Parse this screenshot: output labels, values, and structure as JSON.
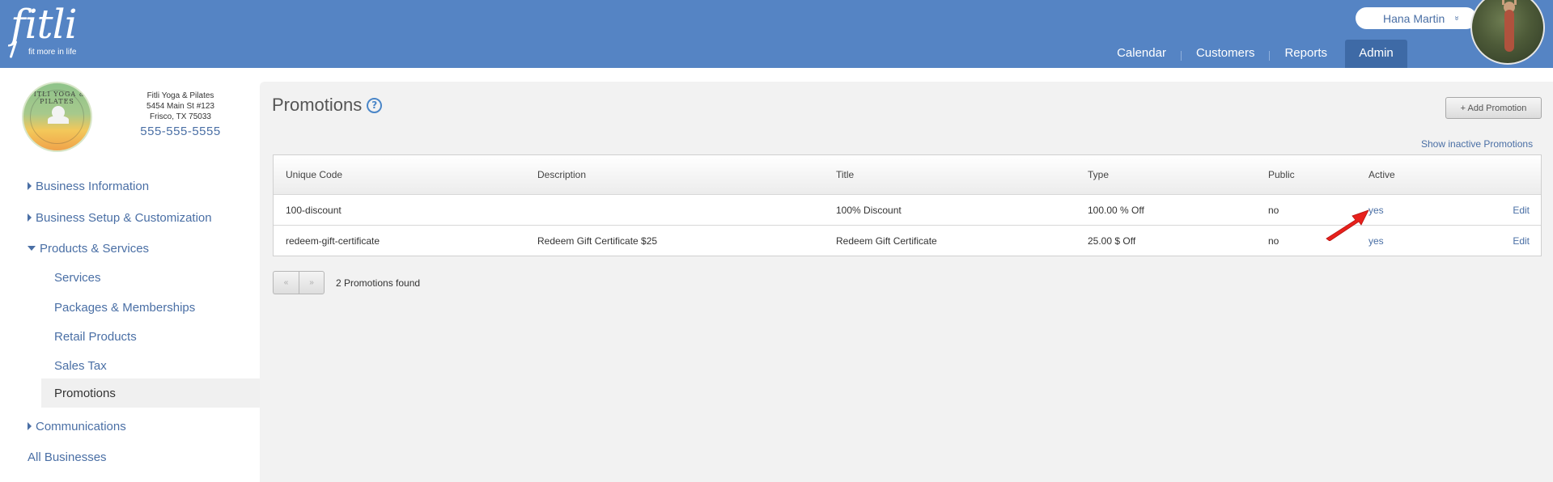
{
  "header": {
    "logo_word": "fitli",
    "logo_tagline": "fit more in life",
    "user_name": "Hana Martin",
    "user_chevron": "»",
    "nav": [
      "Calendar",
      "Customers",
      "Reports",
      "Admin"
    ],
    "active_nav": "Admin",
    "brand_color": "#5584c4"
  },
  "business": {
    "logo_text": "FITLI YOGA & PILATES",
    "name": "Fitli Yoga & Pilates",
    "address1": "5454 Main St #123",
    "address2": "Frisco, TX 75033",
    "phone": "555-555-5555"
  },
  "sidebar": {
    "items": [
      {
        "label": "Business Information",
        "caret": "right"
      },
      {
        "label": "Business Setup & Customization",
        "caret": "right"
      },
      {
        "label": "Products & Services",
        "caret": "down"
      },
      {
        "label": "Services"
      },
      {
        "label": "Packages & Memberships"
      },
      {
        "label": "Retail Products"
      },
      {
        "label": "Sales Tax"
      },
      {
        "label": "Promotions",
        "selected": true
      },
      {
        "label": "Communications",
        "caret": "right"
      },
      {
        "label": "All Businesses"
      }
    ]
  },
  "main": {
    "title": "Promotions",
    "help_icon": "?",
    "add_button": "+ Add Promotion",
    "show_inactive": "Show inactive Promotions",
    "columns": [
      "Unique Code",
      "Description",
      "Title",
      "Type",
      "Public",
      "Active",
      ""
    ],
    "rows": [
      {
        "code": "100-discount",
        "description": "",
        "title": "100% Discount",
        "type": "100.00 % Off",
        "public": "no",
        "active": "yes",
        "action": "Edit"
      },
      {
        "code": "redeem-gift-certificate",
        "description": "Redeem Gift Certificate $25",
        "title": "Redeem Gift Certificate",
        "type": "25.00 $ Off",
        "public": "no",
        "active": "yes",
        "action": "Edit"
      }
    ],
    "pager_prev": "«",
    "pager_next": "»",
    "found_text": "2 Promotions found",
    "annotation_color": "#e8201c"
  }
}
